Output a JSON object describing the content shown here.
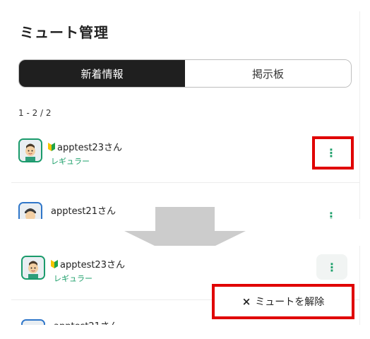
{
  "page": {
    "title": "ミュート管理"
  },
  "tabs": [
    {
      "label": "新着情報",
      "active": true
    },
    {
      "label": "掲示板",
      "active": false
    }
  ],
  "count": "1 - 2 / 2",
  "users": [
    {
      "name": "apptest23さん",
      "badge": "レギュラー",
      "beginner_mark": true
    },
    {
      "name": "apptest21さん"
    }
  ],
  "menu": {
    "close_glyph": "×",
    "unmute_label": "ミュートを解除"
  },
  "colors": {
    "accent_green": "#1ea06b",
    "highlight_red": "#e00000",
    "tab_active_bg": "#1f1f1f",
    "arrow_gray": "#cccccc"
  },
  "icons": {
    "kebab": "more-vertical-icon",
    "beginner": "beginner-mark-icon",
    "arrow": "down-arrow-icon"
  }
}
